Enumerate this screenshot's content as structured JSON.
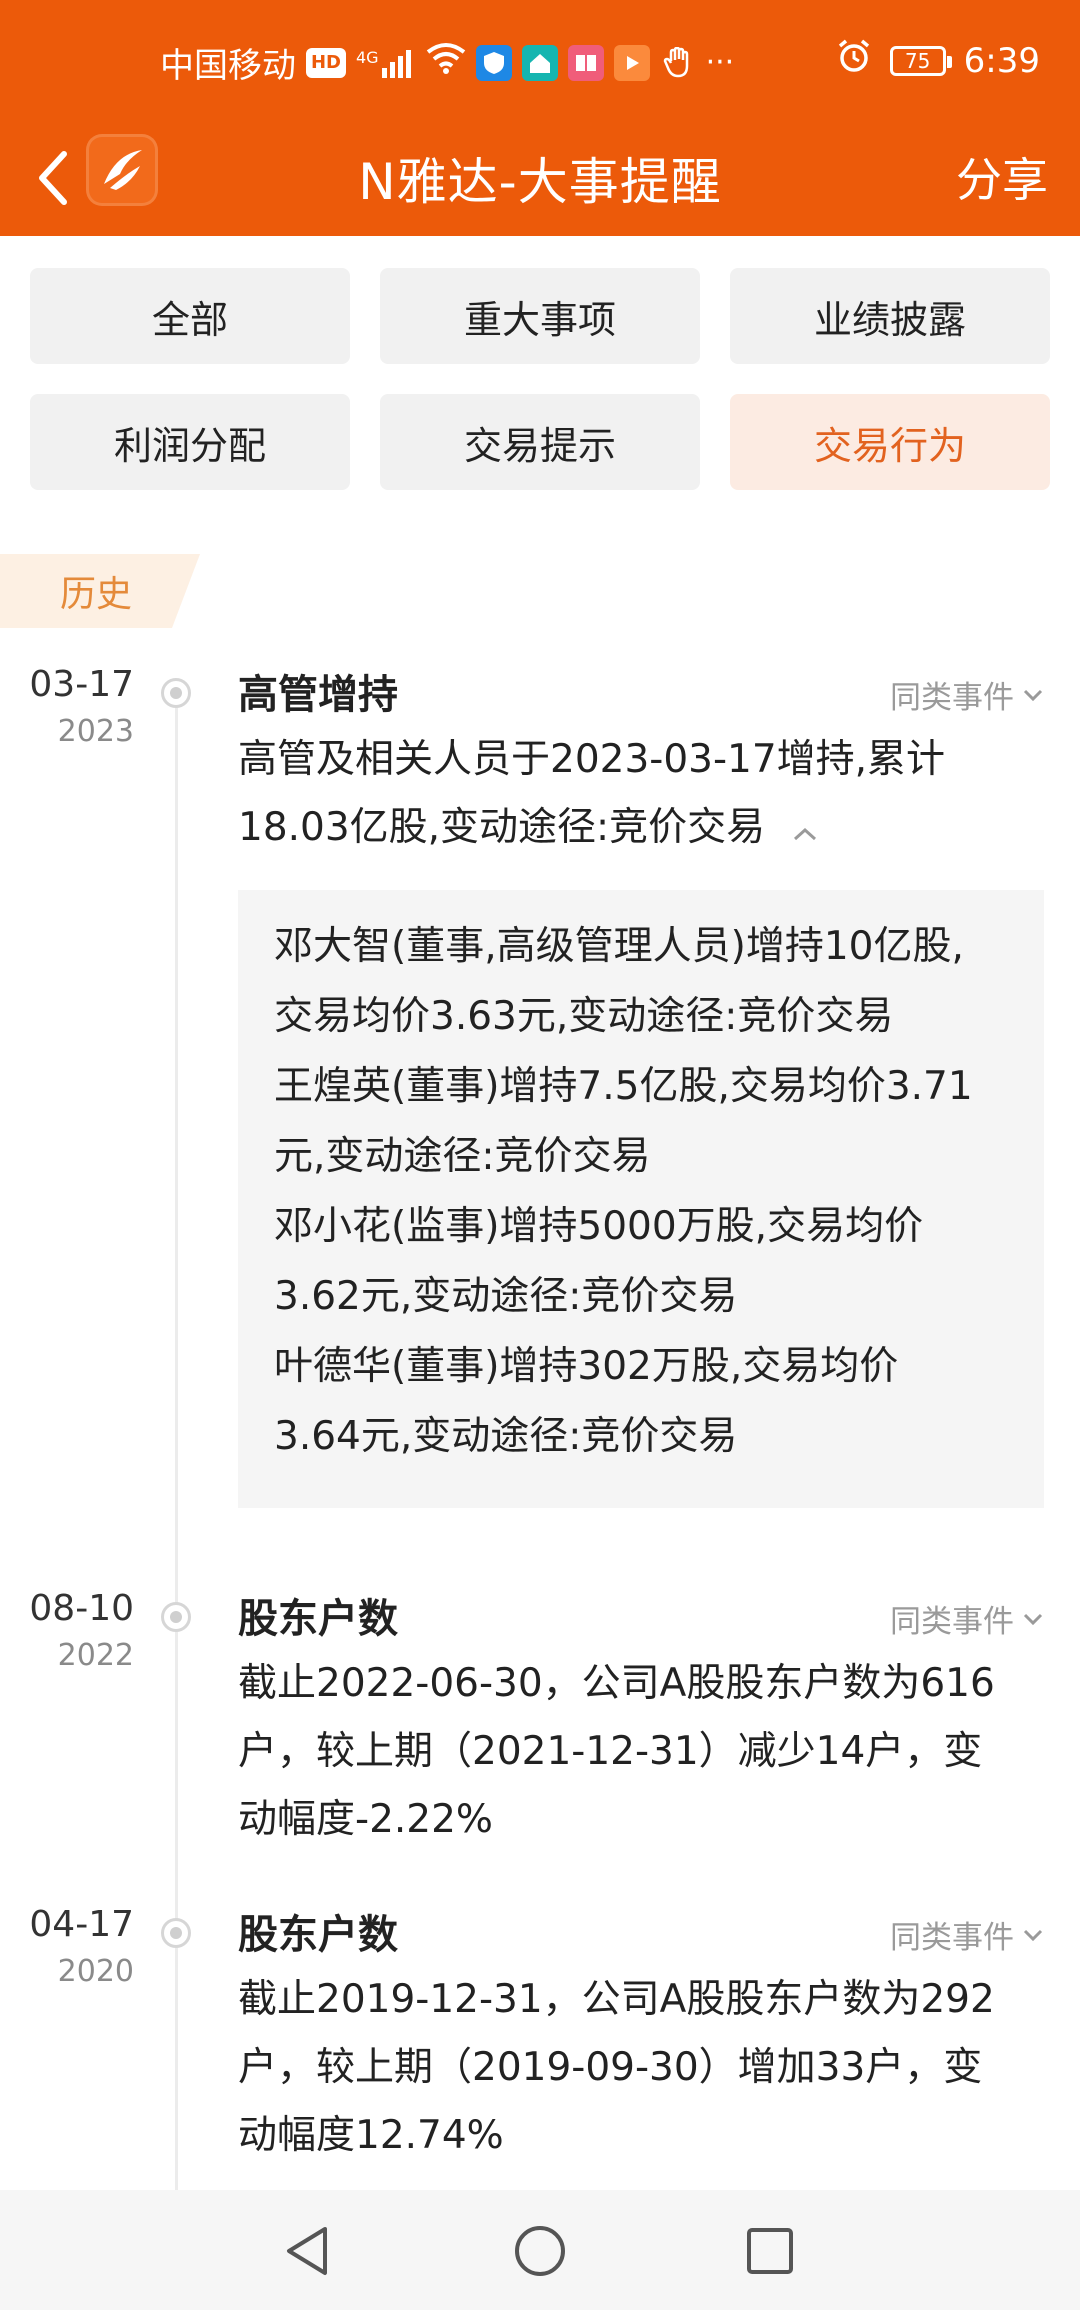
{
  "status": {
    "carrier": "中国移动",
    "hd": "HD",
    "signal": "4G",
    "battery": "75",
    "time": "6:39"
  },
  "header": {
    "title": "N雅达-大事提醒",
    "share": "分享"
  },
  "filters": [
    {
      "label": "全部",
      "active": false
    },
    {
      "label": "重大事项",
      "active": false
    },
    {
      "label": "业绩披露",
      "active": false
    },
    {
      "label": "利润分配",
      "active": false
    },
    {
      "label": "交易提示",
      "active": false
    },
    {
      "label": "交易行为",
      "active": true
    }
  ],
  "history_tag": "历史",
  "same_type_label": "同类事件",
  "events": [
    {
      "date": "03-17",
      "year": "2023",
      "title": "高管增持",
      "desc_line1": "高管及相关人员于2023-03-17增持,累计",
      "desc_line2": "18.03亿股,变动途径:竞价交易",
      "details": [
        "邓大智(董事,高级管理人员)增持10亿股,",
        "交易均价3.63元,变动途径:竞价交易",
        "王煌英(董事)增持7.5亿股,交易均价3.71",
        "元,变动途径:竞价交易",
        "邓小花(监事)增持5000万股,交易均价",
        "3.62元,变动途径:竞价交易",
        "叶德华(董事)增持302万股,交易均价",
        "3.64元,变动途径:竞价交易"
      ]
    },
    {
      "date": "08-10",
      "year": "2022",
      "title": "股东户数",
      "desc_lines": [
        "截止2022-06-30，公司A股股东户数为616",
        "户，较上期（2021-12-31）减少14户，变",
        "动幅度-2.22%"
      ]
    },
    {
      "date": "04-17",
      "year": "2020",
      "title": "股东户数",
      "desc_lines": [
        "截止2019-12-31，公司A股股东户数为292",
        "户，较上期（2019-09-30）增加33户，变",
        "动幅度12.74%"
      ]
    }
  ],
  "colors": {
    "brand": "#ec5a0a",
    "active_chip_bg": "#fcebe2",
    "active_chip_text": "#e2621f"
  }
}
